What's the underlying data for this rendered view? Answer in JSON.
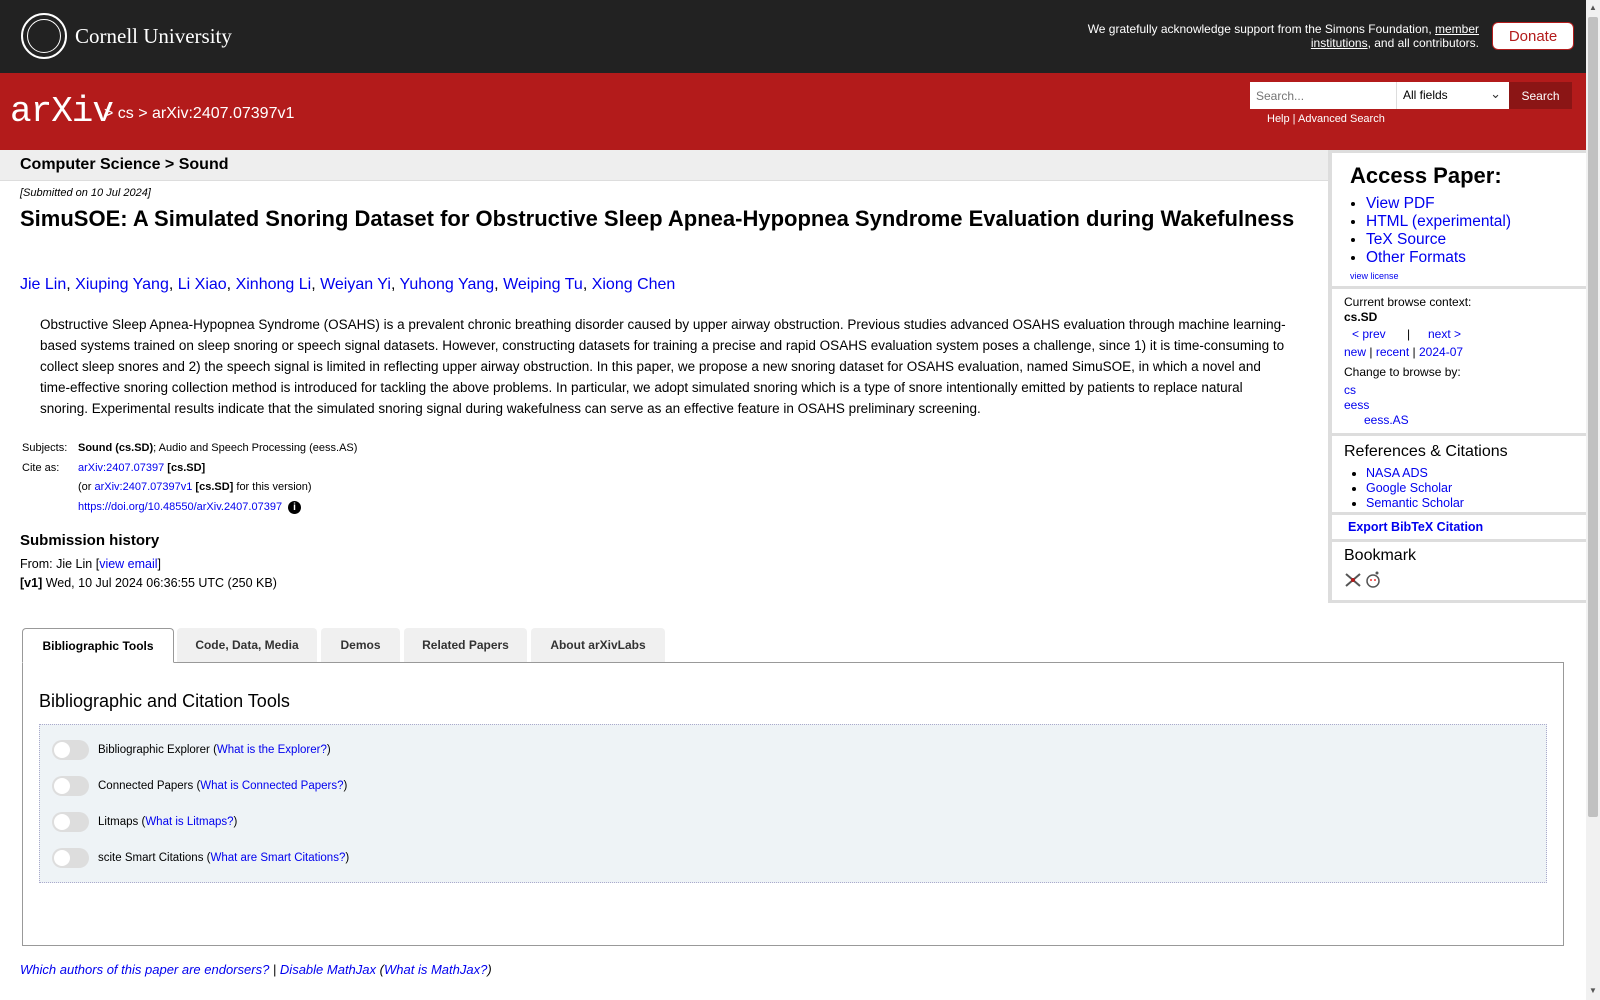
{
  "header": {
    "university": "Cornell University",
    "ack_text": "We gratefully acknowledge support from the Simons Foundation, ",
    "ack_link": "member institutions",
    "ack_tail": ", and all contributors.",
    "donate": "Donate"
  },
  "nav": {
    "logo": "arXiv",
    "sep1": " > ",
    "crumb1": "cs",
    "sep2": " > ",
    "crumb2": "arXiv:2407.07397v1",
    "search_placeholder": "Search...",
    "field_select": "All fields",
    "search_button": "Search",
    "help": "Help",
    "help_sep": " | ",
    "advanced": "Advanced Search"
  },
  "subject_header": "Computer Science > Sound",
  "paper": {
    "submitted": "[Submitted on 10 Jul 2024]",
    "title": "SimuSOE: A Simulated Snoring Dataset for Obstructive Sleep Apnea-Hypopnea Syndrome Evaluation during Wakefulness",
    "authors": [
      "Jie Lin",
      "Xiuping Yang",
      "Li Xiao",
      "Xinhong Li",
      "Weiyan Yi",
      "Yuhong Yang",
      "Weiping Tu",
      "Xiong Chen"
    ],
    "abstract": "Obstructive Sleep Apnea-Hypopnea Syndrome (OSAHS) is a prevalent chronic breathing disorder caused by upper airway obstruction. Previous studies advanced OSAHS evaluation through machine learning-based systems trained on sleep snoring or speech signal datasets. However, constructing datasets for training a precise and rapid OSAHS evaluation system poses a challenge, since 1) it is time-consuming to collect sleep snores and 2) the speech signal is limited in reflecting upper airway obstruction. In this paper, we propose a new snoring dataset for OSAHS evaluation, named SimuSOE, in which a novel and time-effective snoring collection method is introduced for tackling the above problems. In particular, we adopt simulated snoring which is a type of snore intentionally emitted by patients to replace natural snoring. Experimental results indicate that the simulated snoring signal during wakefulness can serve as an effective feature in OSAHS preliminary screening.",
    "subjects_label": "Subjects:",
    "subjects_primary": "Sound (cs.SD)",
    "subjects_rest": "; Audio and Speech Processing (eess.AS)",
    "cite_label": "Cite as:",
    "cite_id": "arXiv:2407.07397",
    "cite_cat": " [cs.SD]",
    "cite_or": "(or ",
    "cite_v1": "arXiv:2407.07397v1",
    "cite_v1_cat": " [cs.SD]",
    "cite_v1_tail": " for this version)",
    "doi": "https://doi.org/10.48550/arXiv.2407.07397",
    "info_icon": "i",
    "history_title": "Submission history",
    "from_label": "From: Jie Lin [",
    "view_email": "view email",
    "from_close": "]",
    "v1_label": "[v1]",
    "v1_text": " Wed, 10 Jul 2024 06:36:55 UTC (250 KB)"
  },
  "sidebar": {
    "access_title": "Access Paper:",
    "access_links": [
      "View PDF",
      "HTML (experimental)",
      "TeX Source",
      "Other Formats"
    ],
    "view_license": "view license",
    "context_label": "Current browse context:",
    "context_value": "cs.SD",
    "prev": "< prev",
    "pipe": "|",
    "next": "next >",
    "new": "new",
    "recent": "recent",
    "month": "2024-07",
    "change_label": "Change to browse by:",
    "browse_cs": "cs",
    "browse_eess": "eess",
    "browse_eess_as": "eess.AS",
    "refs_title": "References & Citations",
    "refs": [
      "NASA ADS",
      "Google Scholar",
      "Semantic Scholar"
    ],
    "export_bibtex": "Export BibTeX Citation",
    "bookmark_title": "Bookmark"
  },
  "tabs": [
    "Bibliographic Tools",
    "Code, Data, Media",
    "Demos",
    "Related Papers",
    "About arXivLabs"
  ],
  "tools_panel": {
    "title": "Bibliographic and Citation Tools",
    "items": [
      {
        "label": "Bibliographic Explorer",
        "link": "What is the Explorer?"
      },
      {
        "label": "Connected Papers",
        "link": "What is Connected Papers?"
      },
      {
        "label": "Litmaps",
        "link": "What is Litmaps?"
      },
      {
        "label": "scite Smart Citations",
        "link": "What are Smart Citations?"
      }
    ]
  },
  "footer": {
    "endorsers": "Which authors of this paper are endorsers?",
    "sep": " | ",
    "disable_mathjax": "Disable MathJax",
    "mathjax_open": " (",
    "what_mathjax": "What is MathJax?",
    "mathjax_close": ")"
  },
  "colors": {
    "arxiv_red": "#b31b1b",
    "header_dark": "#222222",
    "link": "#0000ee"
  }
}
